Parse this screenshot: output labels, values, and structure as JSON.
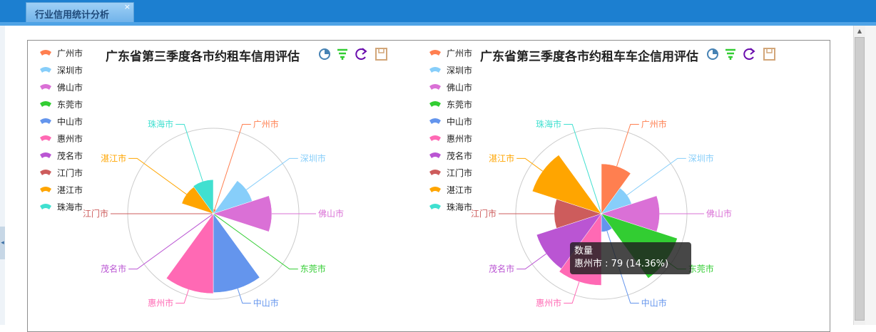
{
  "tab": {
    "label": "行业信用统计分析",
    "close": "×"
  },
  "legend": [
    "广州市",
    "深圳市",
    "佛山市",
    "东莞市",
    "中山市",
    "惠州市",
    "茂名市",
    "江门市",
    "湛江市",
    "珠海市"
  ],
  "colors": [
    "#ff7f50",
    "#87cefa",
    "#da70d6",
    "#32cd32",
    "#6495ed",
    "#ff69b4",
    "#ba55d3",
    "#cd5c5c",
    "#ffa500",
    "#40e0d0"
  ],
  "tooltip": {
    "title": "数量",
    "line": "惠州市 : 79 (14.36%)"
  },
  "chart_data": [
    {
      "type": "pie",
      "title": "广东省第三季度各市约租车信用评估",
      "categories": [
        "广州市",
        "深圳市",
        "佛山市",
        "东莞市",
        "中山市",
        "惠州市",
        "茂名市",
        "江门市",
        "湛江市",
        "珠海市"
      ],
      "values": [
        5,
        42,
        60,
        1,
        81,
        82,
        1,
        1,
        34,
        35
      ]
    },
    {
      "type": "pie",
      "title": "广东省第三季度各市约租车车企信用评估",
      "categories": [
        "广州市",
        "深圳市",
        "佛山市",
        "东莞市",
        "中山市",
        "惠州市",
        "茂名市",
        "江门市",
        "湛江市",
        "珠海市"
      ],
      "values": [
        55,
        35,
        64,
        88,
        20,
        79,
        75,
        52,
        80,
        2
      ]
    }
  ]
}
